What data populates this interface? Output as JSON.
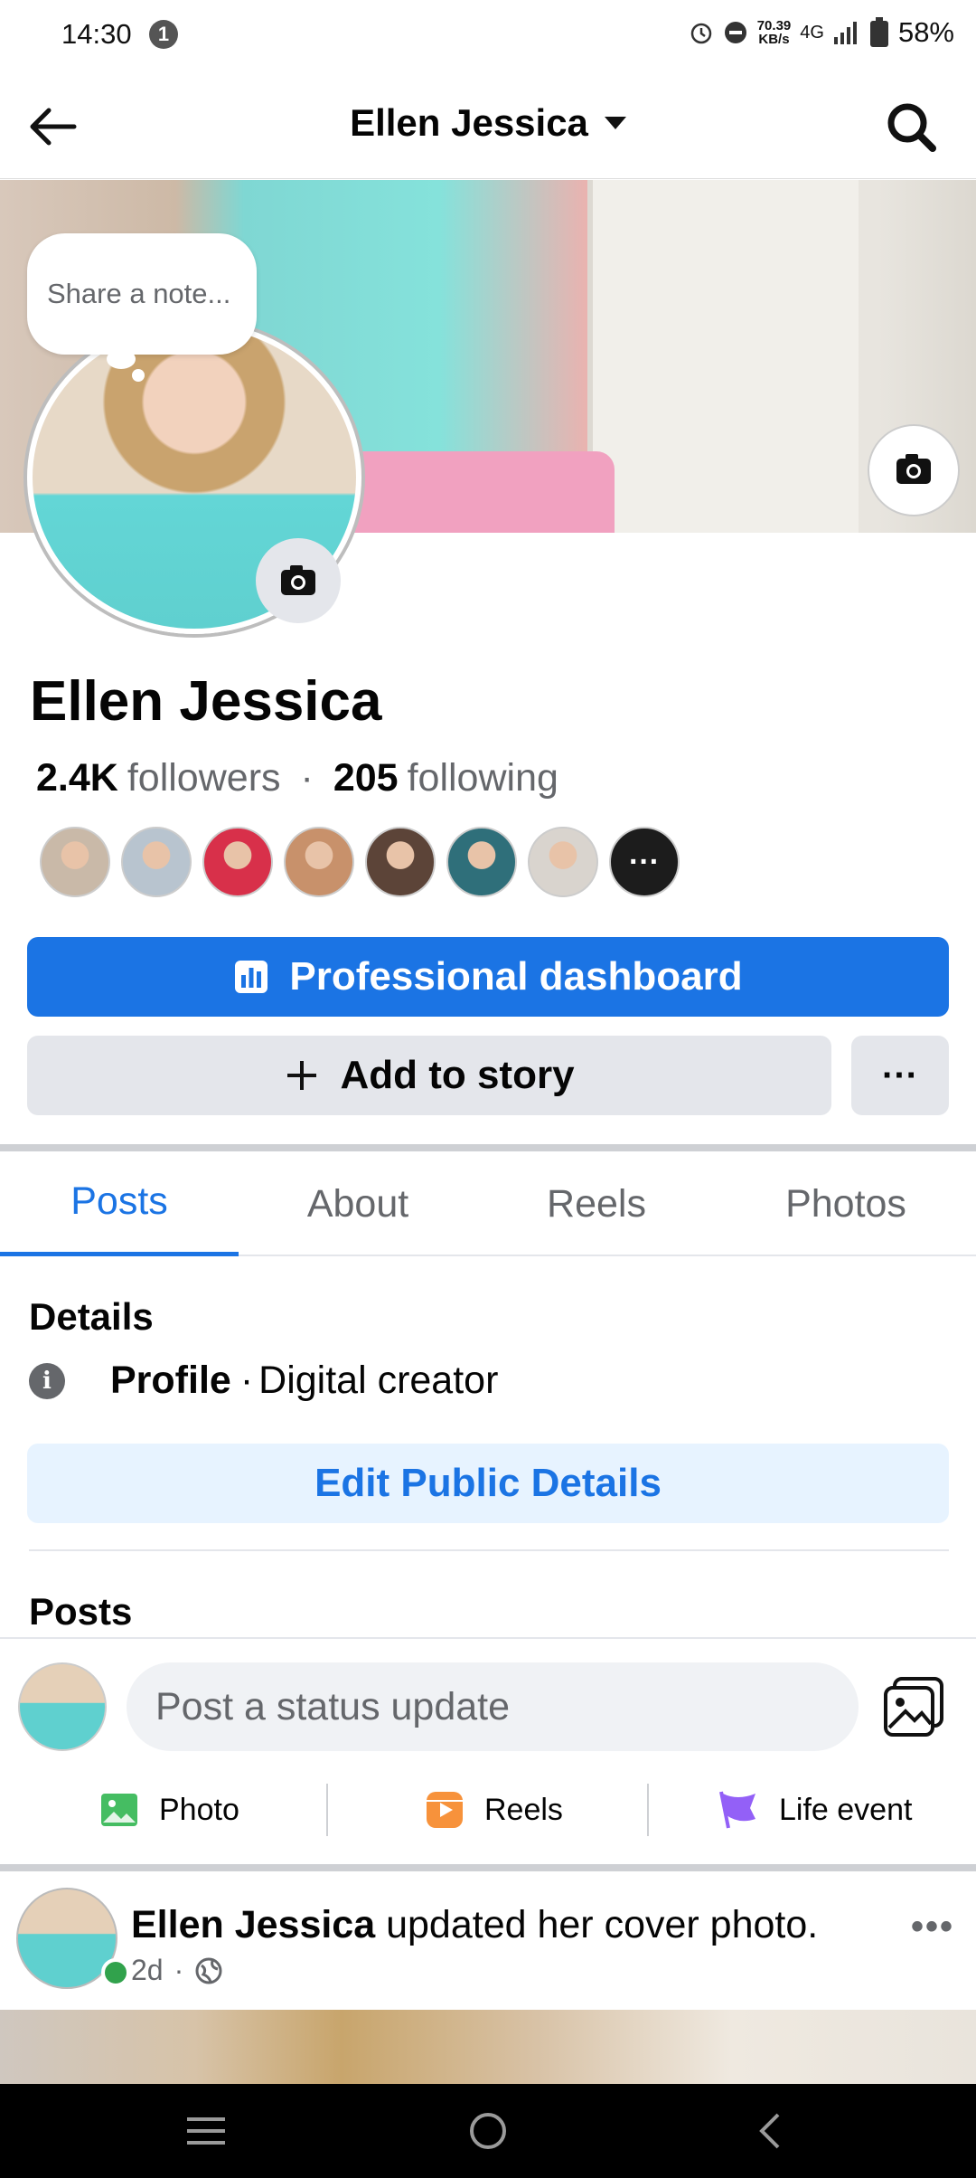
{
  "status_bar": {
    "time": "14:30",
    "notification_count": "1",
    "net_speed_value": "70.39",
    "net_speed_unit": "KB/s",
    "network": "4G",
    "battery": "58%"
  },
  "header": {
    "title": "Ellen Jessica"
  },
  "note": {
    "placeholder": "Share a note..."
  },
  "profile": {
    "name": "Ellen Jessica",
    "followers_count": "2.4K",
    "followers_label": "followers",
    "separator": "·",
    "following_count": "205",
    "following_label": "following",
    "follower_avatars": [
      {
        "color": "#c9b9a8"
      },
      {
        "color": "#b8c4cf"
      },
      {
        "color": "#d8304a"
      },
      {
        "color": "#c8916b"
      },
      {
        "color": "#5c4438"
      },
      {
        "color": "#2f6f7a"
      },
      {
        "color": "#d9d4ce"
      },
      {
        "color": "#1c1c1c"
      }
    ],
    "more_followers_label": "···"
  },
  "actions": {
    "professional_dashboard": "Professional dashboard",
    "add_to_story": "Add to story",
    "more": "···"
  },
  "tabs": [
    {
      "label": "Posts",
      "active": true
    },
    {
      "label": "About",
      "active": false
    },
    {
      "label": "Reels",
      "active": false
    },
    {
      "label": "Photos",
      "active": false
    }
  ],
  "details": {
    "heading": "Details",
    "type_label": "Profile",
    "type_separator": "·",
    "type_value": "Digital creator",
    "edit_button": "Edit Public Details"
  },
  "posts_section": {
    "heading": "Posts",
    "composer_placeholder": "Post a status update",
    "composer_actions": [
      {
        "label": "Photo",
        "icon": "photo-icon",
        "color": "#45bd62"
      },
      {
        "label": "Reels",
        "icon": "reels-icon",
        "color": "#f7923b"
      },
      {
        "label": "Life event",
        "icon": "flag-icon",
        "color": "#9360f7"
      }
    ]
  },
  "post": {
    "author": "Ellen Jessica",
    "action_text": "updated her cover photo.",
    "time": "2d",
    "meta_separator": "·",
    "more": "•••"
  },
  "colors": {
    "primary": "#1b74e4",
    "primary_light": "#e7f3ff",
    "secondary_button": "#e4e6eb",
    "muted_text": "#65676b",
    "online": "#31a24c"
  }
}
